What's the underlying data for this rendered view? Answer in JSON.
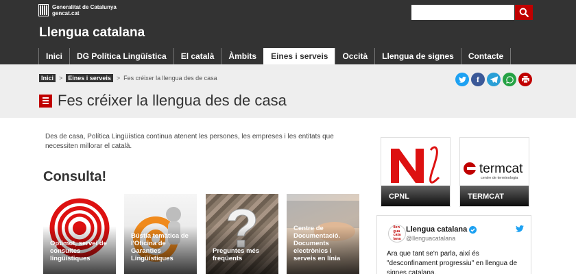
{
  "colors": {
    "header_bg": "#333333",
    "accent": "#c00000",
    "band_bg": "#eeeeee"
  },
  "header": {
    "gov_line1": "Generalitat de Catalunya",
    "gov_line2": "gencat.cat",
    "site_title": "Llengua catalana",
    "search_placeholder": "",
    "search_icon": "search-icon"
  },
  "nav": {
    "items": [
      {
        "label": "Inici",
        "active": false
      },
      {
        "label": "DG Política Lingüística",
        "active": false
      },
      {
        "label": "El català",
        "active": false
      },
      {
        "label": "Àmbits",
        "active": false
      },
      {
        "label": "Eines i serveis",
        "active": true
      },
      {
        "label": "Occità",
        "active": false
      },
      {
        "label": "Llengua de signes",
        "active": false
      },
      {
        "label": "Contacte",
        "active": false
      }
    ]
  },
  "breadcrumb": {
    "items": [
      "Inici",
      "Eines i serveis"
    ],
    "current": "Fes créixer la llengua des de casa"
  },
  "share": [
    "twitter-icon",
    "facebook-icon",
    "telegram-icon",
    "whatsapp-icon",
    "print-icon"
  ],
  "page": {
    "title": "Fes créixer la llengua des de casa",
    "intro": "Des de casa, Política Lingüística continua atenent les persones, les empreses i les entitats que necessiten millorar el català.",
    "section_title": "Consulta!"
  },
  "cards": [
    {
      "label": "Optimot, servei de consultes lingüístiques"
    },
    {
      "label": "Bústia temàtica de l'Oficina de Garanties Lingüístiques"
    },
    {
      "label": "Preguntes més freqüents"
    },
    {
      "label": "Centre de Documentació. Documents electrònics i serveis en línia"
    }
  ],
  "sidebar": {
    "cpnl_label": "CPNL",
    "termcat_label": "TERMCAT",
    "termcat_logo_text": "termcat",
    "termcat_logo_sub": "centre de terminologia"
  },
  "tweet": {
    "logo_text": [
      "llen",
      "gua",
      "cata",
      "lana"
    ],
    "name": "Llengua catalana",
    "handle": "@llenguacatalana",
    "text": "Ara que tant se'n parla, així és \"desconfinament progressiu\" en llengua de signes catalana."
  }
}
